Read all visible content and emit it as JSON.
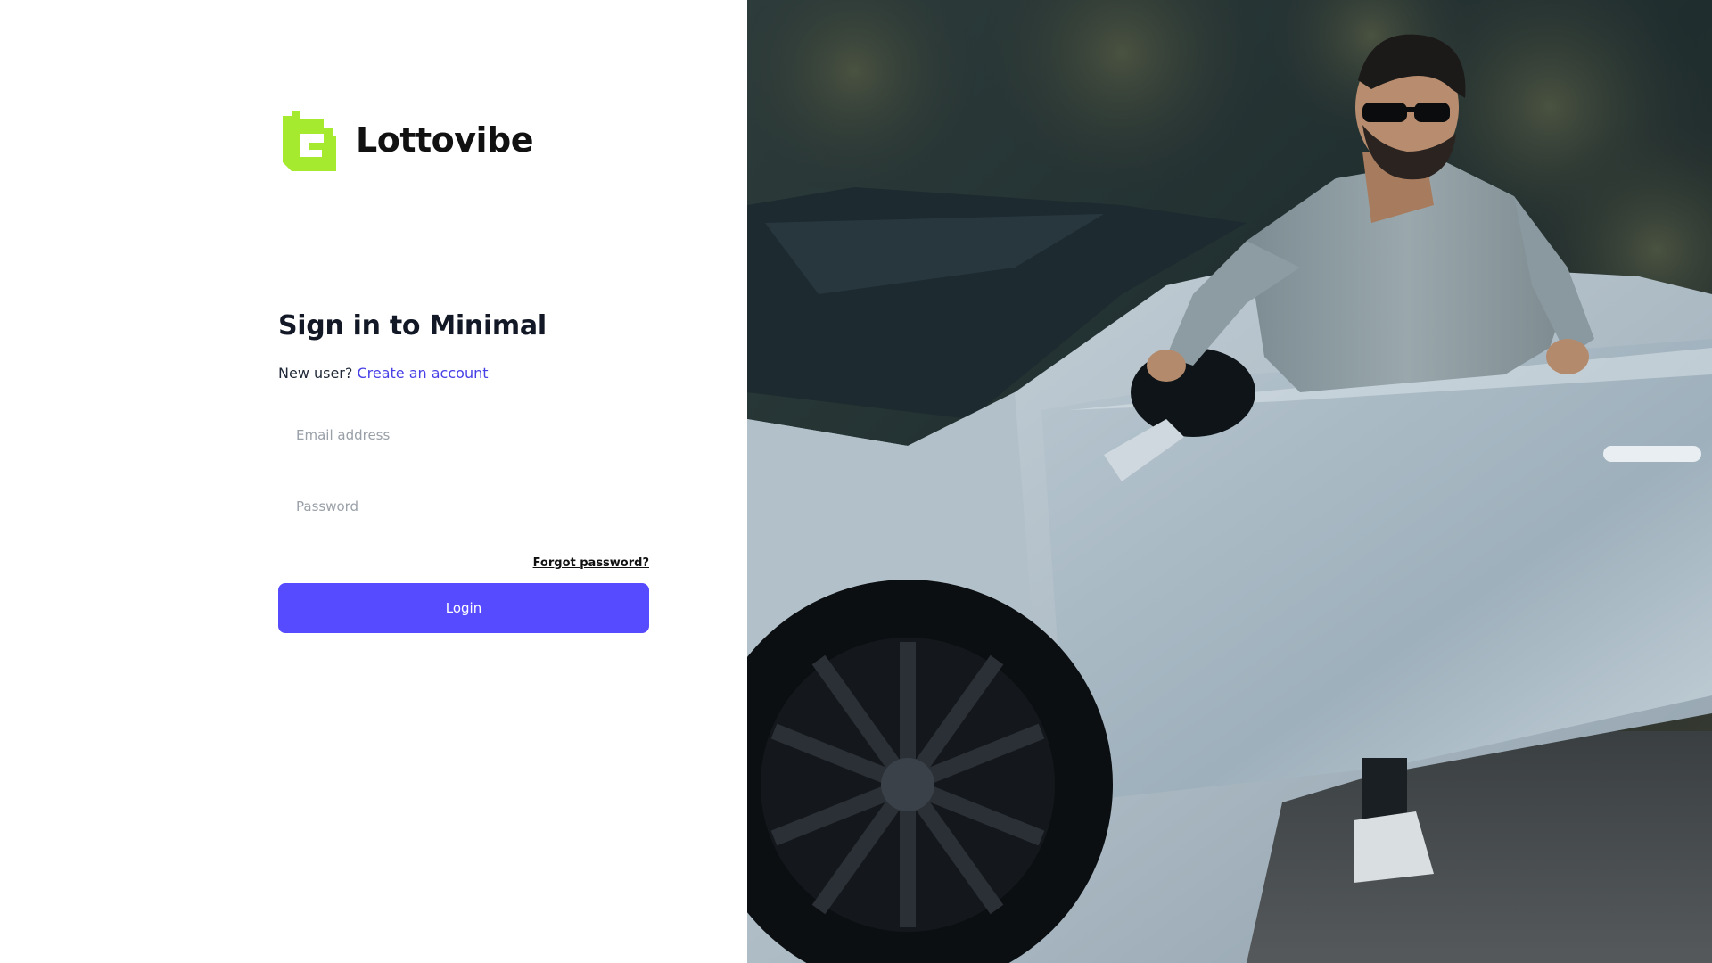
{
  "brand": {
    "name": "Lottovibe",
    "logo_icon": "lottovibe-logo-icon",
    "logo_color": "#a6ea2f"
  },
  "form": {
    "title": "Sign in to Minimal",
    "signup_prompt": "New user?",
    "signup_link": "Create an account",
    "email_placeholder": "Email address",
    "password_placeholder": "Password",
    "forgot_link": "Forgot password?",
    "login_label": "Login"
  },
  "colors": {
    "accent": "#564bff",
    "link": "#4740e6",
    "brand_green": "#a6ea2f"
  },
  "hero_image": {
    "subject": "man-with-sports-car-photo"
  }
}
